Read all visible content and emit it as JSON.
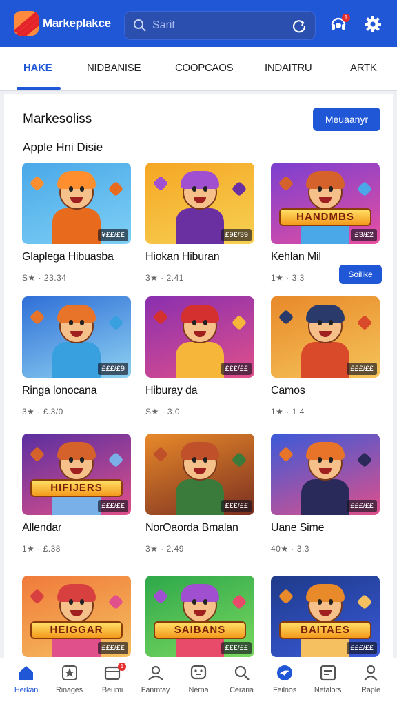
{
  "header": {
    "app_title": "Markeplakce",
    "search_placeholder": "Sarit",
    "notification_count": "1",
    "brand_color": "#1f57d6"
  },
  "tabs": [
    {
      "label": "HAKE",
      "active": true
    },
    {
      "label": "NIDBANISE",
      "active": false
    },
    {
      "label": "COOPCAOS",
      "active": false
    },
    {
      "label": "INDAITRU",
      "active": false
    },
    {
      "label": "ARTK",
      "active": false
    }
  ],
  "section": {
    "title": "Markesoliss",
    "manage_button": "Meuaanyr",
    "subheading": "Apple Hni Disie",
    "sale_button": "Soilike"
  },
  "products": [
    {
      "title": "Glaplega Hibuasba",
      "meta": "S★ · 23.34",
      "price": "¥££/££",
      "palette": [
        "#4aa8e8",
        "#7ed0f5",
        "#ff8f2e",
        "#e86a1c"
      ]
    },
    {
      "title": "Hiokan Hiburan",
      "meta": "3★ · 2.41",
      "price": "£9£/39",
      "palette": [
        "#f5a623",
        "#f7d154",
        "#a04fd0",
        "#6a2fa0"
      ]
    },
    {
      "title": "Kehlan Mil",
      "meta": "1★ · 3.3",
      "price": "£3/£2",
      "palette": [
        "#7a3fd0",
        "#e84fa0",
        "#d5622a",
        "#4aa8e8"
      ],
      "banner": "HANDMBS"
    },
    {
      "title": "Ringa lonocana",
      "meta": "3★ · £.3/0",
      "price": "£££/£9",
      "palette": [
        "#2f6fd8",
        "#8ed1f0",
        "#e8742a",
        "#39a0e0"
      ]
    },
    {
      "title": "Hiburay da",
      "meta": "S★ · 3.0",
      "price": "£££/££",
      "palette": [
        "#8a2fb0",
        "#e0508a",
        "#d43030",
        "#f5b63a"
      ]
    },
    {
      "title": "Camos",
      "meta": "1★ · 1.4",
      "price": "£££/££",
      "palette": [
        "#e8892a",
        "#f5c45a",
        "#2a3a6a",
        "#d84a2a"
      ]
    },
    {
      "title": "Allendar",
      "meta": "1★ · £.38",
      "price": "£££/££",
      "palette": [
        "#5a2fa0",
        "#e0508a",
        "#d5622a",
        "#7ab0e8"
      ],
      "banner": "HIFIJERS"
    },
    {
      "title": "NorOaorda Bmalan",
      "meta": "3★ · 2.49",
      "price": "£££/££",
      "palette": [
        "#e8892a",
        "#7a2f20",
        "#c0502a",
        "#3a7a3a"
      ]
    },
    {
      "title": "Uane Sime",
      "meta": "40★ · 3.3",
      "price": "£££/££",
      "palette": [
        "#3a5ad8",
        "#e0508a",
        "#e8742a",
        "#2a2a5a"
      ]
    },
    {
      "title": "",
      "meta": "",
      "price": "£££/££",
      "palette": [
        "#f07a3a",
        "#f5c060",
        "#d84040",
        "#e0508a"
      ],
      "banner": "HEIGGAR"
    },
    {
      "title": "",
      "meta": "",
      "price": "£££/££",
      "palette": [
        "#2ea84a",
        "#7ad860",
        "#a04fd0",
        "#e84a6a"
      ],
      "banner": "SAIBANS"
    },
    {
      "title": "",
      "meta": "",
      "price": "£££/££",
      "palette": [
        "#1e3a8a",
        "#3a5ad8",
        "#e8892a",
        "#f5c060"
      ],
      "banner": "BAITAES"
    }
  ],
  "bottom_nav": [
    {
      "label": "Herkan",
      "icon": "home-icon",
      "active": true
    },
    {
      "label": "Rinages",
      "icon": "star-badge-icon",
      "active": false
    },
    {
      "label": "Beumi",
      "icon": "inbox-icon",
      "active": false,
      "badge": "1"
    },
    {
      "label": "Fanmtay",
      "icon": "user-icon",
      "active": false
    },
    {
      "label": "Nerna",
      "icon": "chat-face-icon",
      "active": false
    },
    {
      "label": "Ceraria",
      "icon": "search-icon",
      "active": false
    },
    {
      "label": "Feilnos",
      "icon": "bird-icon",
      "active": false
    },
    {
      "label": "Netalors",
      "icon": "message-box-icon",
      "active": false
    },
    {
      "label": "Raple",
      "icon": "profile-icon",
      "active": false
    }
  ]
}
